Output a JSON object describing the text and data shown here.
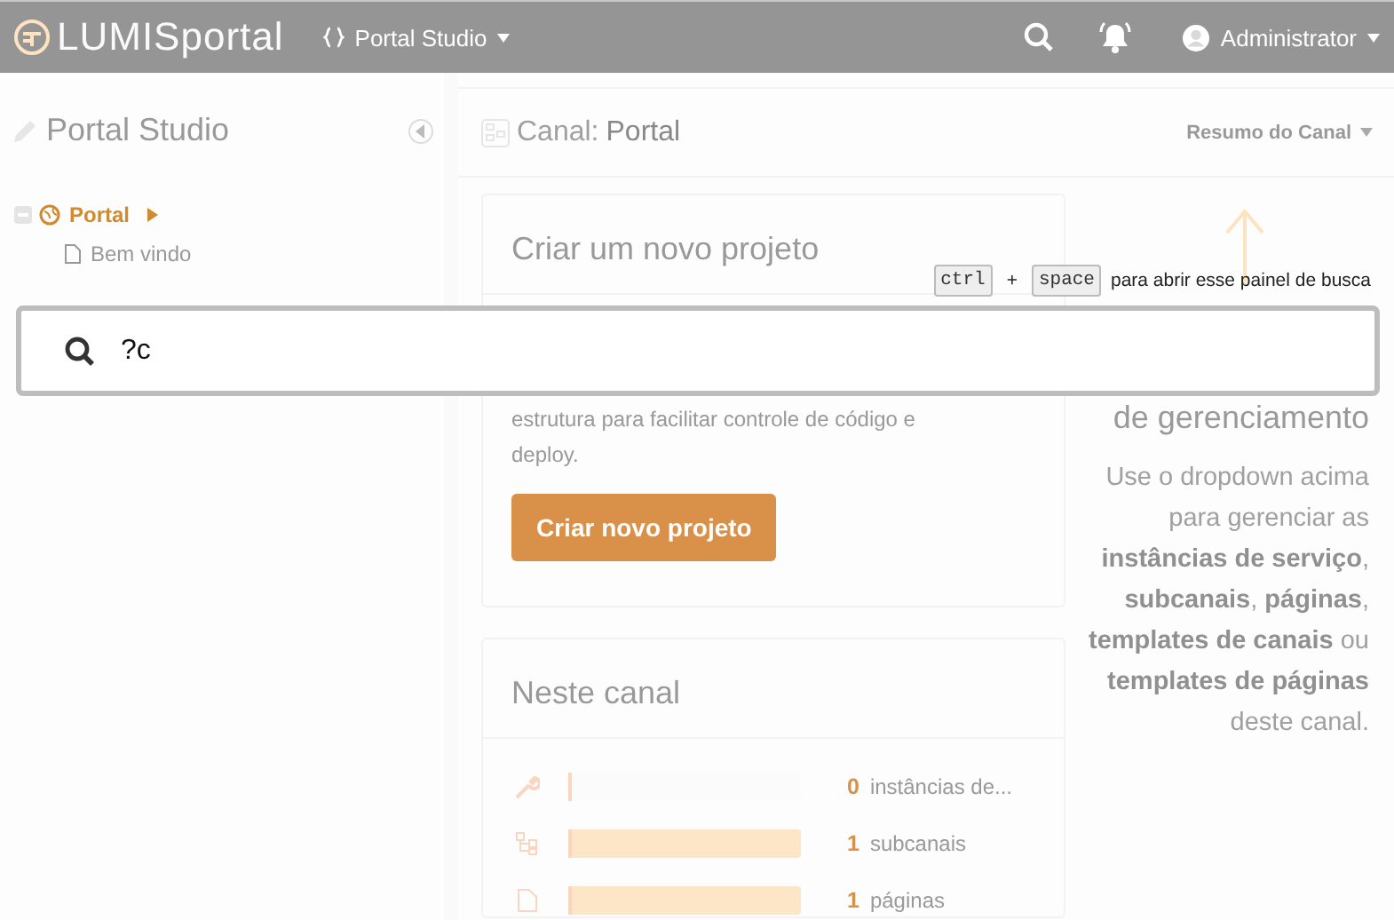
{
  "header": {
    "logo": "LUMISportal",
    "studio_menu": "Portal Studio",
    "user": "Administrator"
  },
  "sidebar": {
    "title": "Portal Studio",
    "tree": [
      {
        "label": "Portal",
        "selected": true,
        "children": [
          {
            "label": "Bem vindo",
            "selected": false
          }
        ]
      }
    ]
  },
  "main": {
    "title_prefix": "Canal:",
    "title": "Portal",
    "summary_menu": "Resumo do Canal",
    "create_card": {
      "title": "Criar um novo projeto",
      "text": "estrutura para facilitar controle de código e deploy.",
      "button": "Criar novo projeto"
    },
    "channel_card": {
      "title": "Neste canal",
      "items": [
        {
          "kind": "service",
          "level": 0,
          "count": "0",
          "label": "instâncias de..."
        },
        {
          "kind": "channel",
          "level": 1,
          "count": "1",
          "label": "subcanais"
        },
        {
          "kind": "page",
          "level": 1,
          "count": "1",
          "label": "páginas"
        }
      ]
    },
    "help": {
      "heading": "de gerenciamento",
      "text": "Use o dropdown acima para gerenciar as **instâncias de serviço**, **subcanais**, **páginas**, **templates de canais** ou **templates de páginas** deste canal."
    }
  },
  "search": {
    "value": "?c",
    "hint_keys": [
      "ctrl",
      "space"
    ],
    "hint_plus": "+",
    "hint_text": "para abrir esse painel de busca"
  }
}
